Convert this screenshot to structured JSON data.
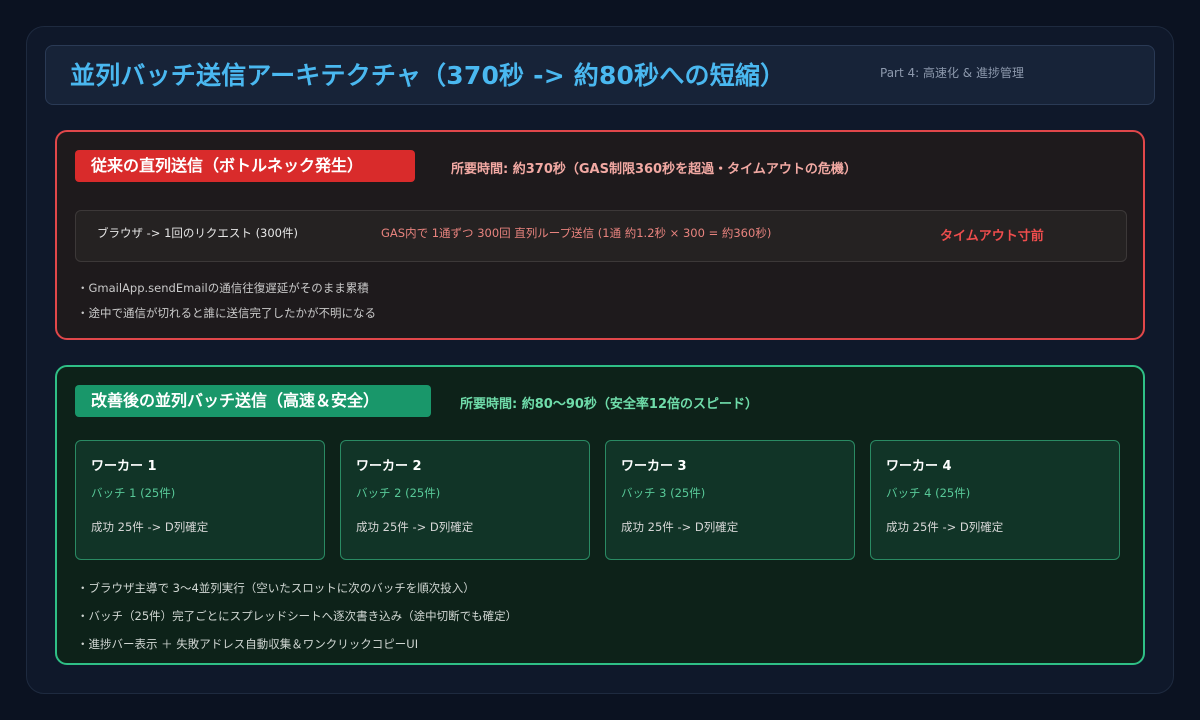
{
  "header": {
    "title": "並列バッチ送信アーキテクチャ（370秒 -> 約80秒への短縮）",
    "part_label": "Part 4: 高速化 & 進捗管理"
  },
  "before": {
    "badge": "従来の直列送信（ボトルネック発生）",
    "time": "所要時間: 約370秒（GAS制限360秒を超過・タイムアウトの危機）",
    "flow": {
      "browser": "ブラウザ -> 1回のリクエスト (300件)",
      "gas": "GAS内で 1通ずつ 300回 直列ループ送信 (1通 約1.2秒 × 300 = 約360秒)",
      "warning": "タイムアウト寸前"
    },
    "bullets": [
      "・GmailApp.sendEmailの通信往復遅延がそのまま累積",
      "・途中で通信が切れると誰に送信完了したかが不明になる"
    ]
  },
  "after": {
    "badge": "改善後の並列バッチ送信（高速＆安全）",
    "time": "所要時間: 約80〜90秒（安全率12倍のスピード）",
    "workers": [
      {
        "name": "ワーカー 1",
        "batch": "バッチ 1 (25件)",
        "result": "成功 25件 -> D列確定"
      },
      {
        "name": "ワーカー 2",
        "batch": "バッチ 2 (25件)",
        "result": "成功 25件 -> D列確定"
      },
      {
        "name": "ワーカー 3",
        "batch": "バッチ 3 (25件)",
        "result": "成功 25件 -> D列確定"
      },
      {
        "name": "ワーカー 4",
        "batch": "バッチ 4 (25件)",
        "result": "成功 25件 -> D列確定"
      }
    ],
    "bullets": [
      "・ブラウザ主導で 3〜4並列実行（空いたスロットに次のバッチを順次投入）",
      "・バッチ（25件）完了ごとにスプレッドシートへ逐次書き込み（途中切断でも確定）",
      "・進捗バー表示 ＋ 失敗アドレス自動収集＆ワンクリックコピーUI"
    ]
  },
  "colors": {
    "title": "#4ab8f0",
    "before_accent": "#e0474a",
    "after_accent": "#2fbf86"
  }
}
